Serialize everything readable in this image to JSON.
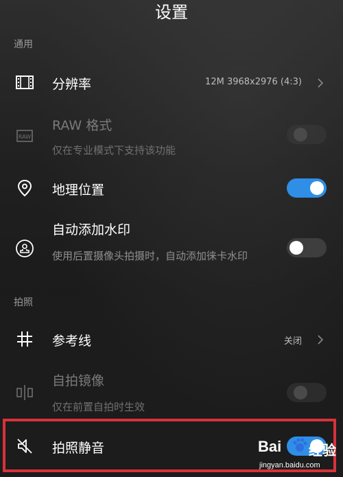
{
  "header": {
    "title": "设置"
  },
  "sections": {
    "general": "通用",
    "photo": "拍照"
  },
  "resolution": {
    "label": "分辨率",
    "value": "12M 3968x2976 (4:3)"
  },
  "raw": {
    "label": "RAW 格式",
    "sub": "仅在专业模式下支持该功能",
    "state": "disabled"
  },
  "location": {
    "label": "地理位置",
    "state": "on"
  },
  "watermark_setting": {
    "label": "自动添加水印",
    "sub": "使用后置摄像头拍摄时，自动添加徕卡水印",
    "state": "off"
  },
  "gridline": {
    "label": "参考线",
    "value": "关闭"
  },
  "mirror": {
    "label": "自拍镜像",
    "sub": "仅在前置自拍时生效",
    "state": "disabled"
  },
  "mute": {
    "label": "拍照静音",
    "state": "on"
  },
  "overlay": {
    "brand": "Bai",
    "brand_cn": "经验",
    "url": "jingyan.baidu.com"
  },
  "colors": {
    "accent": "#2f8fe6",
    "highlight": "#d8323a"
  }
}
